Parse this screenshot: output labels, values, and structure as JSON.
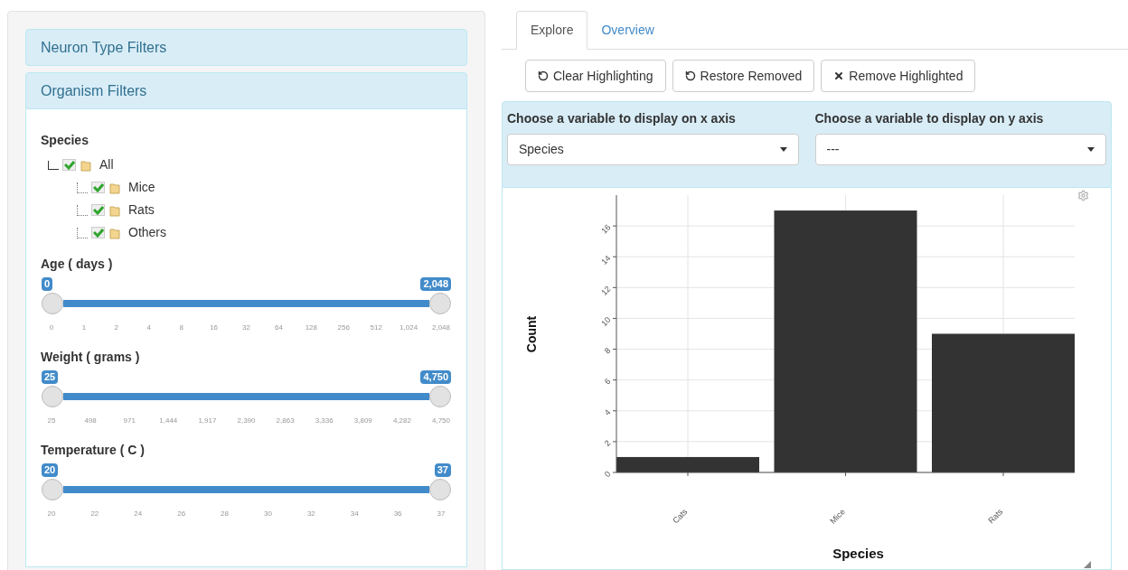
{
  "filter_panel": {
    "accordions": [
      {
        "title": "Neuron Type Filters",
        "expanded": false
      },
      {
        "title": "Organism Filters",
        "expanded": true,
        "species": {
          "label": "Species",
          "tree": [
            {
              "label": "All",
              "checked": true,
              "children": [
                {
                  "label": "Mice",
                  "checked": true
                },
                {
                  "label": "Rats",
                  "checked": true
                },
                {
                  "label": "Others",
                  "checked": true
                }
              ]
            }
          ]
        },
        "sliders": [
          {
            "label": "Age ( days )",
            "low": "0",
            "high": "2,048",
            "level": 1,
            "ticks": [
              "0",
              "1",
              "2",
              "4",
              "8",
              "16",
              "32",
              "64",
              "128",
              "256",
              "512",
              "1,024",
              "2,048"
            ]
          },
          {
            "label": "Weight ( grams )",
            "low": "25",
            "high": "4,750",
            "level": 1,
            "ticks": [
              "25",
              "498",
              "971",
              "1,444",
              "1,917",
              "2,390",
              "2,863",
              "3,336",
              "3,809",
              "4,282",
              "4,750"
            ]
          },
          {
            "label": "Temperature ( C )",
            "low": "20",
            "high": "37",
            "level": 1,
            "ticks": [
              "20",
              "22",
              "24",
              "26",
              "28",
              "30",
              "32",
              "34",
              "36",
              "37"
            ]
          }
        ]
      }
    ]
  },
  "tabs": [
    {
      "label": "Explore",
      "selected": true
    },
    {
      "label": "Overview",
      "selected": false
    }
  ],
  "buttons": [
    {
      "label": "Clear Highlighting",
      "kind": "undo"
    },
    {
      "label": "Restore Removed",
      "kind": "undo"
    },
    {
      "label": "Remove Highlighted",
      "kind": "remove"
    }
  ],
  "axis_selectors": [
    {
      "label": "Choose a variable to display on x axis",
      "value": "Species"
    },
    {
      "label": "Choose a variable to display on y axis",
      "value": "---"
    }
  ],
  "chart": {
    "chart_data": {
      "type": "bar",
      "xlabel": "Species",
      "ylabel": "Count",
      "categories": [
        "Cats",
        "Mice",
        "Rats"
      ],
      "values": [
        1,
        17,
        9
      ],
      "ylim": [
        0,
        18
      ],
      "grid": true,
      "yticks": [
        0,
        2,
        4,
        6,
        8,
        10,
        12,
        14,
        16
      ]
    }
  }
}
